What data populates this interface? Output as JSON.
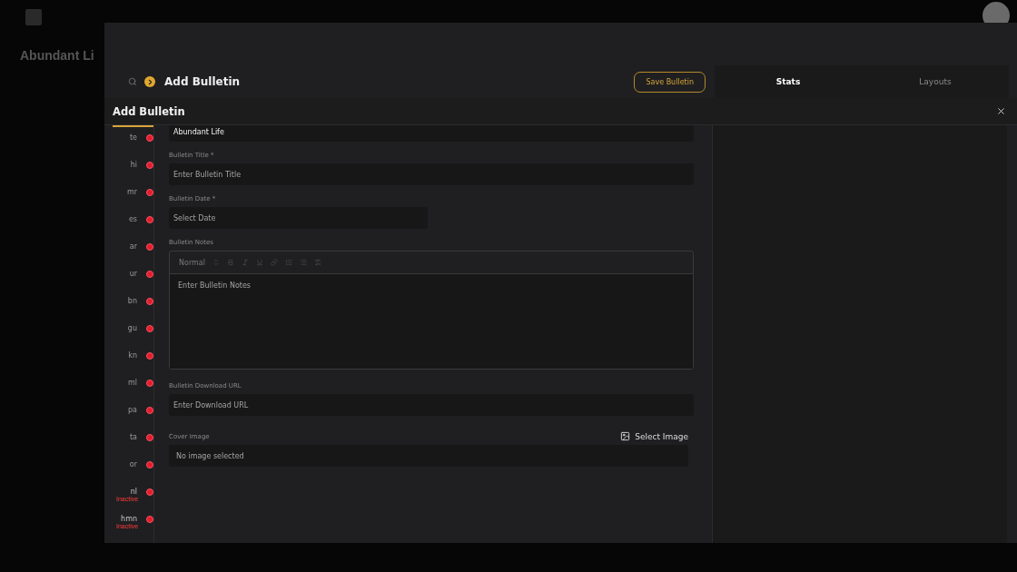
{
  "background": {
    "title": "Abundant Li"
  },
  "header": {
    "title": "Add Bulletin",
    "save_button": "Save Bulletin"
  },
  "side_tabs": [
    {
      "label": "Stats",
      "selected": true
    },
    {
      "label": "Layouts",
      "selected": false
    }
  ],
  "dialog": {
    "title": "Add Bulletin"
  },
  "languages": [
    {
      "code": "te",
      "selected": true,
      "inactive": false
    },
    {
      "code": "hi",
      "selected": false,
      "inactive": false
    },
    {
      "code": "mr",
      "selected": false,
      "inactive": false
    },
    {
      "code": "es",
      "selected": false,
      "inactive": false
    },
    {
      "code": "ar",
      "selected": false,
      "inactive": false
    },
    {
      "code": "ur",
      "selected": false,
      "inactive": false
    },
    {
      "code": "bn",
      "selected": false,
      "inactive": false
    },
    {
      "code": "gu",
      "selected": false,
      "inactive": false
    },
    {
      "code": "kn",
      "selected": false,
      "inactive": false
    },
    {
      "code": "ml",
      "selected": false,
      "inactive": false
    },
    {
      "code": "pa",
      "selected": false,
      "inactive": false
    },
    {
      "code": "ta",
      "selected": false,
      "inactive": false
    },
    {
      "code": "or",
      "selected": false,
      "inactive": false
    },
    {
      "code": "nl",
      "selected": false,
      "inactive": true,
      "status": "Inactive"
    },
    {
      "code": "hmn",
      "selected": false,
      "inactive": true,
      "status": "Inactive"
    }
  ],
  "form": {
    "church": {
      "value": "Abundant Life"
    },
    "title": {
      "label": "Bulletin Title *",
      "placeholder": "Enter Bulletin Title"
    },
    "date": {
      "label": "Bulletin Date *",
      "placeholder": "Select Date"
    },
    "notes": {
      "label": "Bulletin Notes",
      "format": "Normal",
      "placeholder": "Enter Bulletin Notes"
    },
    "url": {
      "label": "Bulletin Download URL",
      "placeholder": "Enter Download URL"
    },
    "cover": {
      "label": "Cover Image",
      "button": "Select Image",
      "empty": "No image selected"
    }
  }
}
